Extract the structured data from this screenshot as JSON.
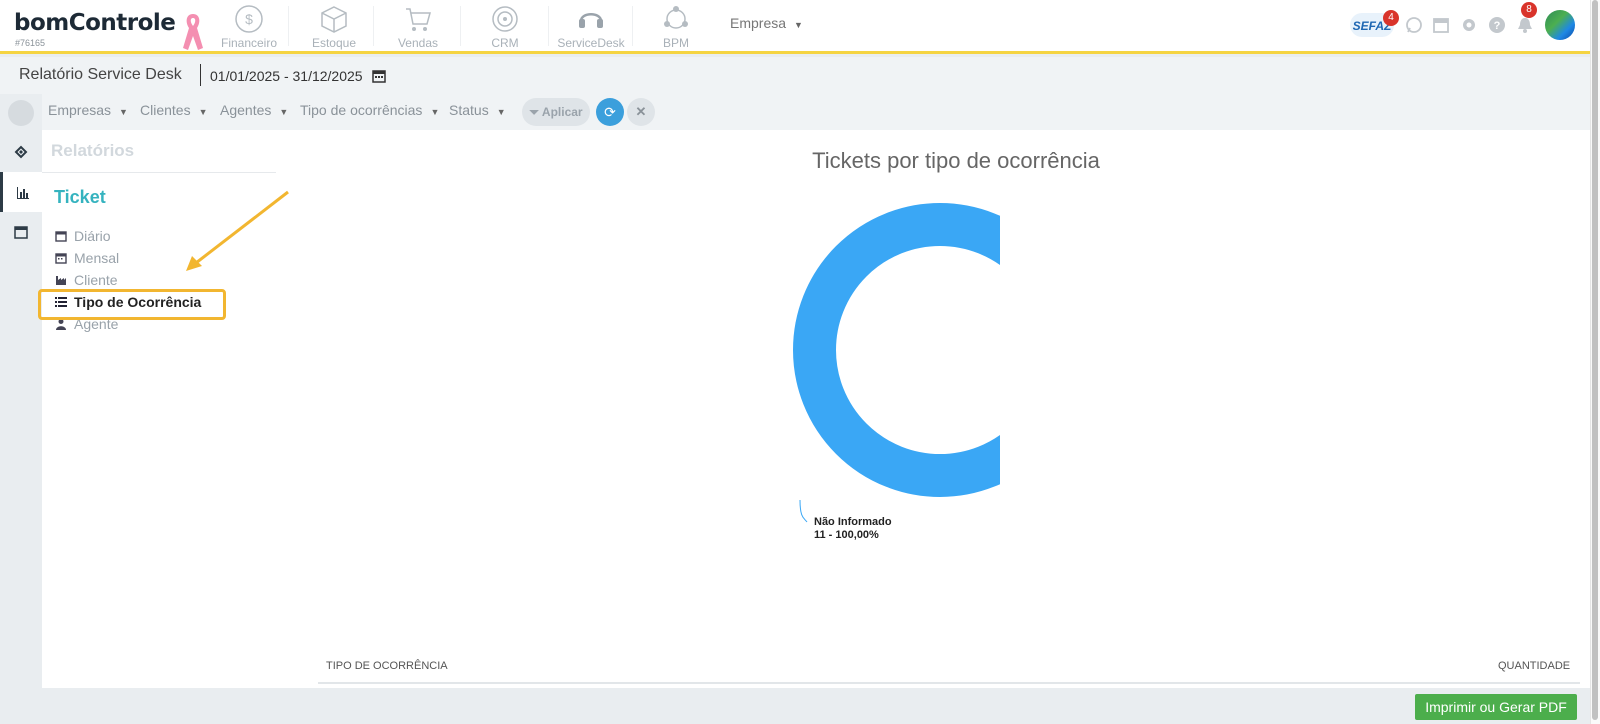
{
  "header": {
    "logo": "bomControle",
    "account_id": "#76165",
    "modules": [
      {
        "label": "Financeiro",
        "icon": "dollar-icon"
      },
      {
        "label": "Estoque",
        "icon": "box-icon"
      },
      {
        "label": "Vendas",
        "icon": "cart-icon"
      },
      {
        "label": "CRM",
        "icon": "target-icon"
      },
      {
        "label": "ServiceDesk",
        "icon": "headset-icon"
      },
      {
        "label": "BPM",
        "icon": "network-icon"
      }
    ],
    "company_menu": "Empresa",
    "sefaz_label": "SEFAZ",
    "sefaz_badge": "4",
    "notifications_badge": "8"
  },
  "title_bar": {
    "title": "Relatório Service Desk",
    "date_range": "01/01/2025 - 31/12/2025"
  },
  "filters": {
    "items": [
      "Empresas",
      "Clientes",
      "Agentes",
      "Tipo de ocorrências",
      "Status"
    ],
    "apply_label": "Aplicar"
  },
  "side_menu": {
    "title": "Relatórios",
    "section": "Ticket",
    "items": [
      {
        "label": "Diário",
        "icon": "calendar-icon"
      },
      {
        "label": "Mensal",
        "icon": "calendar-icon"
      },
      {
        "label": "Cliente",
        "icon": "industry-icon"
      },
      {
        "label": "Tipo de Ocorrência",
        "icon": "list-icon",
        "active": true
      },
      {
        "label": "Agente",
        "icon": "user-icon"
      }
    ]
  },
  "chart_data": {
    "type": "pie",
    "title": "Tickets por tipo de ocorrência",
    "categories": [
      "Não Informado"
    ],
    "values": [
      11
    ],
    "labels": [
      "Não Informado",
      "11 - 100,00%"
    ],
    "colors": [
      "#3aa7f5"
    ]
  },
  "table": {
    "columns": [
      "TIPO DE OCORRÊNCIA",
      "QUANTIDADE"
    ]
  },
  "footer": {
    "print_button": "Imprimir ou Gerar PDF"
  },
  "colors": {
    "accent": "#35b3bf",
    "top_border": "#f5d442",
    "highlight": "#f2b630",
    "refresh": "#3b9fdc",
    "pdf_button": "#4cae4c"
  }
}
